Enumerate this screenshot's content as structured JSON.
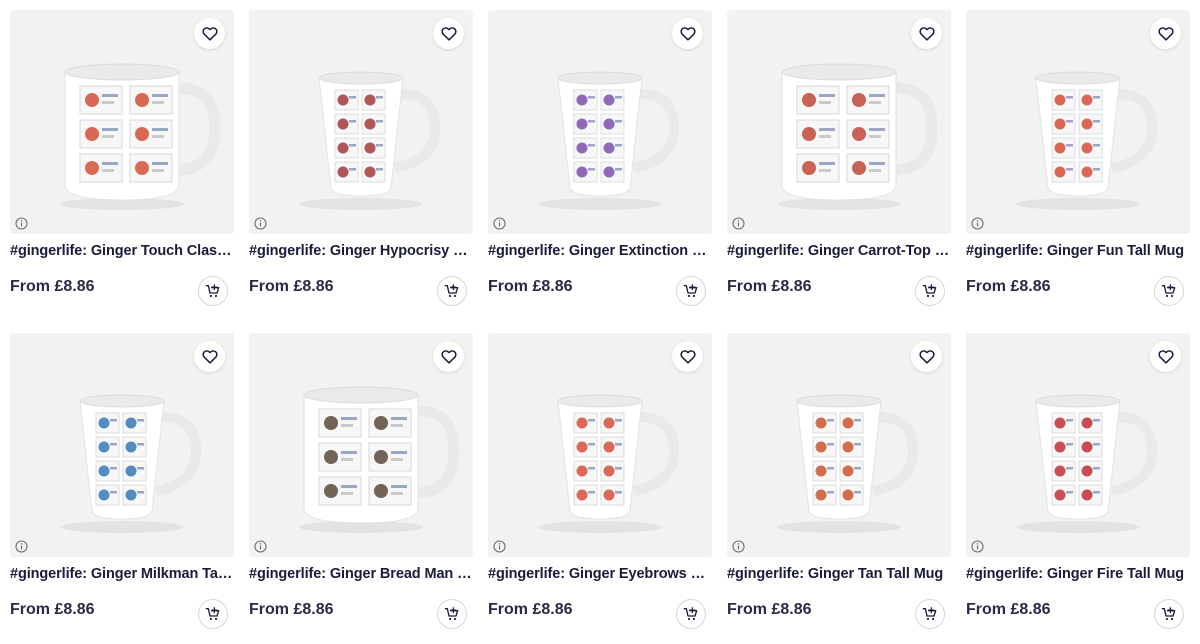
{
  "products": [
    {
      "title": "#gingerlife: Ginger Touch Classic Mug",
      "price": "From £8.86",
      "shape": "classic",
      "accent": "#d4503a"
    },
    {
      "title": "#gingerlife: Ginger Hypocrisy Tall Mug",
      "price": "From £8.86",
      "shape": "tall",
      "accent": "#a43a3a"
    },
    {
      "title": "#gingerlife: Ginger Extinction Tall Mug",
      "price": "From £8.86",
      "shape": "tall",
      "accent": "#7a4fb0"
    },
    {
      "title": "#gingerlife: Ginger Carrot-Top Classic Mug",
      "price": "From £8.86",
      "shape": "classic",
      "accent": "#c0463a"
    },
    {
      "title": "#gingerlife: Ginger Fun Tall Mug",
      "price": "From £8.86",
      "shape": "tall",
      "accent": "#d4503a"
    },
    {
      "title": "#gingerlife: Ginger Milkman Tall Mug",
      "price": "From £8.86",
      "shape": "tall",
      "accent": "#3a78b8"
    },
    {
      "title": "#gingerlife: Ginger Bread Man Classic Mug",
      "price": "From £8.86",
      "shape": "classic",
      "accent": "#5a4a3a"
    },
    {
      "title": "#gingerlife: Ginger Eyebrows Tall Mug",
      "price": "From £8.86",
      "shape": "tall",
      "accent": "#d4503a"
    },
    {
      "title": "#gingerlife: Ginger Tan Tall Mug",
      "price": "From £8.86",
      "shape": "tall",
      "accent": "#c8552e"
    },
    {
      "title": "#gingerlife: Ginger Fire Tall Mug",
      "price": "From £8.86",
      "shape": "tall",
      "accent": "#c0303a"
    }
  ],
  "icons": {
    "favorite": "heart-icon",
    "info": "info-icon",
    "cart": "add-to-cart-icon"
  }
}
